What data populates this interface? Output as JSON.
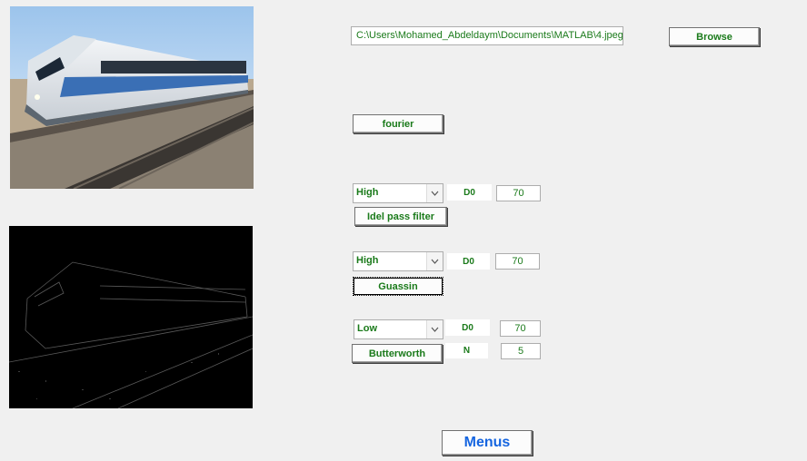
{
  "file_path": "C:\\Users\\Mohamed_Abdeldaym\\Documents\\MATLAB\\4.jpeg",
  "browse_label": "Browse",
  "fourier_label": "fourier",
  "ideal": {
    "select_value": "High",
    "d0_label": "D0",
    "d0_value": "70",
    "button_label": "Idel pass filter"
  },
  "gaussian": {
    "select_value": "High",
    "d0_label": "D0",
    "d0_value": "70",
    "button_label": "Guassin"
  },
  "butterworth": {
    "select_value": "Low",
    "d0_label": "D0",
    "d0_value": "70",
    "n_label": "N",
    "n_value": "5",
    "button_label": "Butterworth"
  },
  "menus_label": "Menus",
  "colors": {
    "text_green": "#1a7a1a",
    "menus_blue": "#1565e0"
  }
}
